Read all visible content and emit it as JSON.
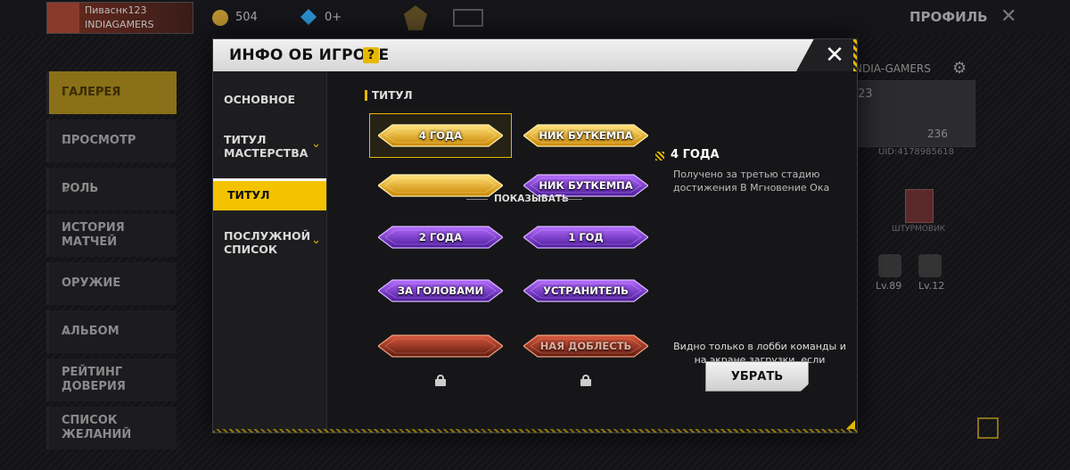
{
  "background": {
    "player_name": "Пиваснк123",
    "guild_name": "INDIAGAMERS",
    "coins": "504",
    "diamonds": "0+",
    "profile_label": "ПРОФИЛЬ",
    "right_panel": {
      "guild": "NDIA-GAMERS",
      "level": "23",
      "likes": "236",
      "uid": "UID:4178985618",
      "badge_label": "ШТУРМОВИК",
      "pet1_level": "Lv.89",
      "pet2_level": "Lv.12"
    },
    "nav": [
      {
        "label": "ГАЛЕРЕЯ"
      },
      {
        "label": "ПРОСМОТР"
      },
      {
        "label": "РОЛЬ"
      },
      {
        "label": "ИСТОРИЯ\nМАТЧЕЙ"
      },
      {
        "label": "ОРУЖИЕ"
      },
      {
        "label": "АЛЬБОМ"
      },
      {
        "label": "РЕЙТИНГ\nДОВЕРИЯ"
      },
      {
        "label": "СПИСОК\nЖЕЛАНИЙ"
      }
    ]
  },
  "modal": {
    "title": "ИНФО ОБ ИГРОКЕ",
    "help_symbol": "?",
    "close_symbol": "✕",
    "tabs": [
      {
        "label": "ОСНОВНОЕ"
      },
      {
        "label": "ТИТУЛ\nМАСТЕРСТВА"
      },
      {
        "label": "ТИТУЛ"
      },
      {
        "label": "ПОСЛУЖНОЙ\nСПИСОК"
      }
    ],
    "section_title": "ТИТУЛ",
    "show_label": "ПОКАЗЫВАТЬ",
    "titles": [
      {
        "label": "4 ГОДА",
        "style": "gold"
      },
      {
        "label": "НИК БУТКЕМПА",
        "style": "gold"
      },
      {
        "label": "",
        "style": "gold"
      },
      {
        "label": "НИК БУТКЕМПА",
        "style": "purple"
      },
      {
        "label": "2 ГОДА",
        "style": "purple"
      },
      {
        "label": "1 ГОД",
        "style": "purple"
      },
      {
        "label": "ЗА ГОЛОВАМИ",
        "style": "purple"
      },
      {
        "label": "УСТРАНИТЕЛЬ",
        "style": "purple"
      },
      {
        "label": "",
        "style": "red",
        "locked": true
      },
      {
        "label": "НАЯ ДОБЛЕСТЬ",
        "style": "red",
        "locked": true
      }
    ],
    "detail": {
      "title": "4 ГОДА",
      "description": "Получено за третью стадию достижения В Мгновение Ока",
      "note": "Видно только в лобби команды и на экране загрузки, если экипировано",
      "remove_button": "УБРАТЬ"
    },
    "colors": {
      "accent": "#f3c300",
      "gold": "#e0a000",
      "purple": "#7b2fd6",
      "red": "#b0341f"
    }
  }
}
